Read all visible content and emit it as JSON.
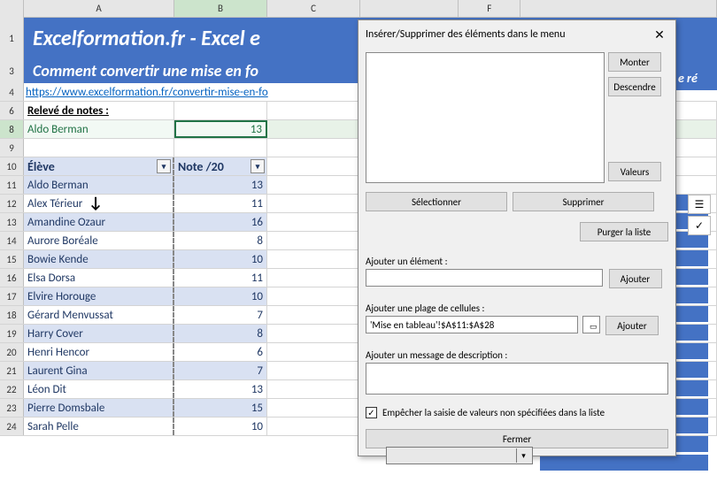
{
  "columns": {
    "A": "A",
    "B": "B",
    "C": "C",
    "F": "F"
  },
  "title": "Excelformation.fr - Excel e",
  "subtitle": "Comment convertir une mise en fo",
  "subtitle_right": "e ré",
  "link": "https://www.excelformation.fr/convertir-mise-en-fo",
  "section_label": "Relevé de notes :",
  "selected": {
    "name": "Aldo Berman",
    "note": "13"
  },
  "table": {
    "headers": {
      "eleve": "Élève",
      "note": "Note /20"
    },
    "rows": [
      {
        "n": 11,
        "eleve": "Aldo Berman",
        "note": "13"
      },
      {
        "n": 12,
        "eleve": "Alex Térieur",
        "note": "11"
      },
      {
        "n": 13,
        "eleve": "Amandine Ozaur",
        "note": "16"
      },
      {
        "n": 14,
        "eleve": "Aurore Boréale",
        "note": "8"
      },
      {
        "n": 15,
        "eleve": "Bowie Kende",
        "note": "10"
      },
      {
        "n": 16,
        "eleve": "Elsa Dorsa",
        "note": "11"
      },
      {
        "n": 17,
        "eleve": "Elvire Horouge",
        "note": "10"
      },
      {
        "n": 18,
        "eleve": "Gérard Menvussat",
        "note": "7"
      },
      {
        "n": 19,
        "eleve": "Harry Cover",
        "note": "8"
      },
      {
        "n": 20,
        "eleve": "Henri Hencor",
        "note": "6"
      },
      {
        "n": 21,
        "eleve": "Laurent Gina",
        "note": "7"
      },
      {
        "n": 22,
        "eleve": "Léon Dit",
        "note": "13"
      },
      {
        "n": 23,
        "eleve": "Pierre Domsbale",
        "note": "15"
      },
      {
        "n": 24,
        "eleve": "Sarah Pelle",
        "note": "10"
      }
    ]
  },
  "rownums": {
    "r1": "1",
    "r3": "3",
    "r4": "4",
    "r6": "6",
    "r8": "8",
    "r9": "9",
    "r10": "10"
  },
  "dialog": {
    "title": "Insérer/Supprimer des éléments dans le menu",
    "btn_monter": "Monter",
    "btn_descendre": "Descendre",
    "btn_valeurs": "Valeurs",
    "btn_select": "Sélectionner",
    "btn_suppr": "Supprimer",
    "btn_purger": "Purger la liste",
    "lbl_add_elem": "Ajouter un élément :",
    "btn_ajouter": "Ajouter",
    "lbl_add_range": "Ajouter une plage de cellules :",
    "range_value": "'Mise en tableau'!$A$11:$A$28",
    "lbl_add_desc": "Ajouter un message de description :",
    "chk_label": "Empêcher la saisie de valeurs non spécifiées dans la liste",
    "btn_fermer": "Fermer"
  },
  "icons": {
    "list": "☰",
    "check": "✓"
  }
}
